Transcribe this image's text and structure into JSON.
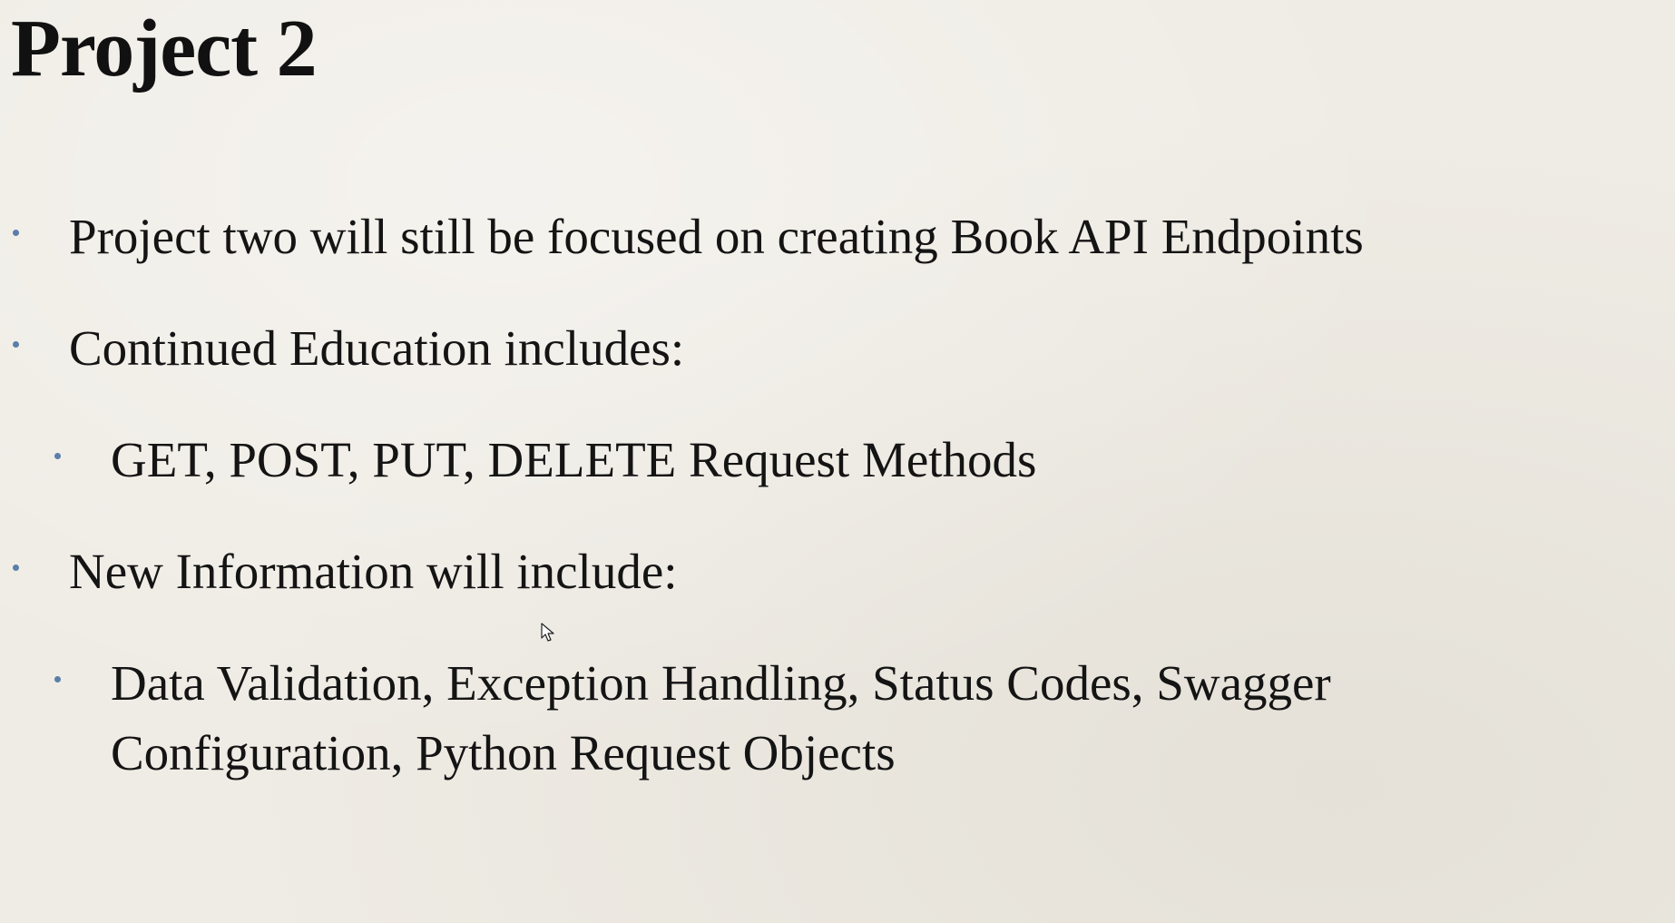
{
  "slide": {
    "title": "Project 2",
    "bullets": [
      {
        "level": 1,
        "text": "Project two will still be focused on creating Book API Endpoints"
      },
      {
        "level": 1,
        "text": "Continued Education includes:"
      },
      {
        "level": 2,
        "text": "GET, POST, PUT, DELETE Request Methods"
      },
      {
        "level": 1,
        "text": "New Information will include:"
      },
      {
        "level": 2,
        "text": "Data Validation, Exception Handling, Status Codes, Swagger Configuration, Python Request Objects"
      }
    ]
  },
  "colors": {
    "background": "#efece5",
    "text": "#141414",
    "bullet": "#5a7fa8"
  },
  "icons": {
    "cursor": "mouse-pointer-icon"
  }
}
